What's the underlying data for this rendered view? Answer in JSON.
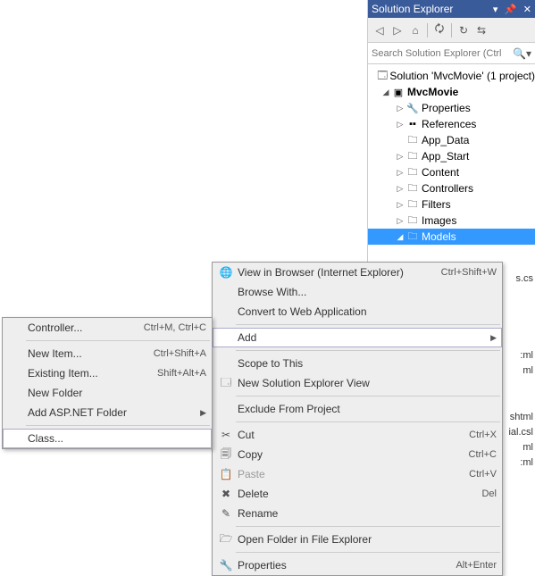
{
  "se": {
    "title": "Solution Explorer",
    "searchPlaceholder": "Search Solution Explorer (Ctrl",
    "solution": "Solution 'MvcMovie' (1 project)",
    "project": "MvcMovie",
    "nodes": {
      "properties": "Properties",
      "references": "References",
      "appdata": "App_Data",
      "appstart": "App_Start",
      "content": "Content",
      "controllers": "Controllers",
      "filters": "Filters",
      "images": "Images",
      "models": "Models"
    }
  },
  "partials": {
    "p1": "s.cs",
    "p2": ":ml",
    "p3": "ml",
    "p4": "shtml",
    "p5": "ial.csl",
    "p6": "ml",
    "p7": ":ml"
  },
  "menu": {
    "viewBrowser": "View in Browser (Internet Explorer)",
    "viewBrowserSc": "Ctrl+Shift+W",
    "browseWith": "Browse With...",
    "convert": "Convert to Web Application",
    "add": "Add",
    "scope": "Scope to This",
    "newView": "New Solution Explorer View",
    "exclude": "Exclude From Project",
    "cut": "Cut",
    "cutSc": "Ctrl+X",
    "copy": "Copy",
    "copySc": "Ctrl+C",
    "paste": "Paste",
    "pasteSc": "Ctrl+V",
    "delete": "Delete",
    "deleteSc": "Del",
    "rename": "Rename",
    "openFolder": "Open Folder in File Explorer",
    "properties": "Properties",
    "propertiesSc": "Alt+Enter"
  },
  "sub": {
    "controller": "Controller...",
    "controllerSc": "Ctrl+M, Ctrl+C",
    "newItem": "New Item...",
    "newItemSc": "Ctrl+Shift+A",
    "existingItem": "Existing Item...",
    "existingItemSc": "Shift+Alt+A",
    "newFolder": "New Folder",
    "addAsp": "Add ASP.NET Folder",
    "class": "Class..."
  }
}
